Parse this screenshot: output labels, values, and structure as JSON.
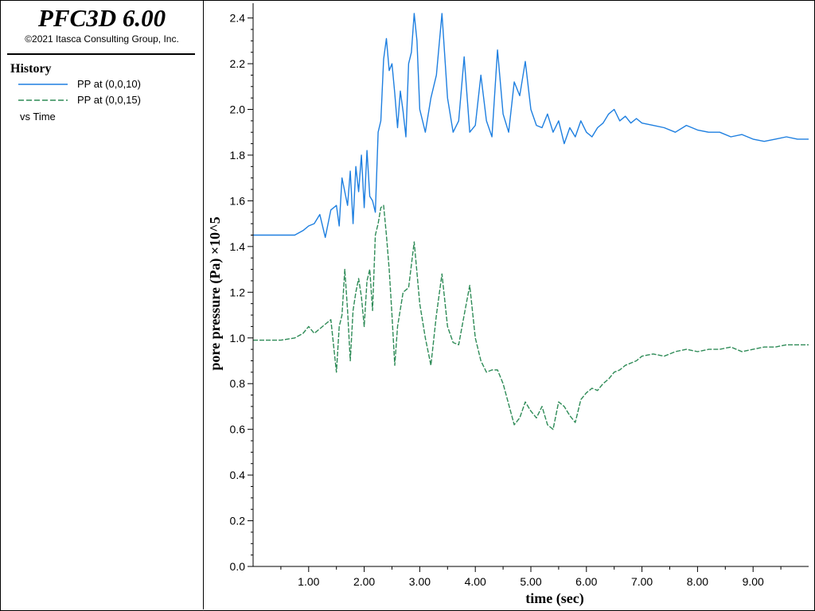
{
  "app": {
    "title": "PFC3D 6.00",
    "copyright": "©2021 Itasca Consulting Group, Inc."
  },
  "legend": {
    "heading": "History",
    "items": [
      {
        "label": "PP at (0,0,10)",
        "color": "#1e7fe0",
        "style": "solid"
      },
      {
        "label": "PP at (0,0,15)",
        "color": "#2e8b57",
        "style": "dashed"
      }
    ],
    "vs_label": "vs Time"
  },
  "chart_data": {
    "type": "line",
    "xlabel": "time (sec)",
    "ylabel": "pore pressure (Pa) ×10^5",
    "xlim": [
      0.0,
      10.0
    ],
    "ylim": [
      0.0,
      2.43
    ],
    "x_ticks": [
      "1.00",
      "2.00",
      "3.00",
      "4.00",
      "5.00",
      "6.00",
      "7.00",
      "8.00",
      "9.00"
    ],
    "y_ticks": [
      "0.0",
      "0.2",
      "0.4",
      "0.6",
      "0.8",
      "1.0",
      "1.2",
      "1.4",
      "1.6",
      "1.8",
      "2.0",
      "2.2",
      "2.4"
    ],
    "grid": false,
    "legend_position": "left-panel",
    "series": [
      {
        "name": "PP at (0,0,10)",
        "color": "#1e7fe0",
        "style": "solid",
        "x": [
          0.0,
          0.5,
          0.75,
          0.9,
          1.0,
          1.1,
          1.2,
          1.3,
          1.4,
          1.5,
          1.55,
          1.6,
          1.7,
          1.75,
          1.8,
          1.85,
          1.9,
          1.95,
          2.0,
          2.05,
          2.1,
          2.15,
          2.2,
          2.25,
          2.3,
          2.35,
          2.4,
          2.45,
          2.5,
          2.55,
          2.6,
          2.65,
          2.7,
          2.75,
          2.8,
          2.85,
          2.9,
          2.95,
          3.0,
          3.1,
          3.2,
          3.3,
          3.4,
          3.5,
          3.6,
          3.7,
          3.8,
          3.9,
          4.0,
          4.1,
          4.2,
          4.3,
          4.4,
          4.5,
          4.6,
          4.7,
          4.8,
          4.9,
          5.0,
          5.1,
          5.2,
          5.3,
          5.4,
          5.5,
          5.6,
          5.7,
          5.8,
          5.9,
          6.0,
          6.1,
          6.2,
          6.3,
          6.4,
          6.5,
          6.6,
          6.7,
          6.8,
          6.9,
          7.0,
          7.2,
          7.4,
          7.6,
          7.8,
          8.0,
          8.2,
          8.4,
          8.6,
          8.8,
          9.0,
          9.2,
          9.4,
          9.6,
          9.8,
          10.0
        ],
        "y": [
          1.45,
          1.45,
          1.45,
          1.47,
          1.49,
          1.5,
          1.54,
          1.44,
          1.56,
          1.58,
          1.49,
          1.7,
          1.58,
          1.73,
          1.5,
          1.75,
          1.64,
          1.8,
          1.57,
          1.82,
          1.62,
          1.6,
          1.55,
          1.9,
          1.95,
          2.22,
          2.31,
          2.17,
          2.2,
          2.07,
          1.92,
          2.08,
          1.99,
          1.88,
          2.2,
          2.25,
          2.42,
          2.3,
          2.0,
          1.9,
          2.05,
          2.15,
          2.42,
          2.05,
          1.9,
          1.95,
          2.23,
          1.9,
          1.93,
          2.15,
          1.95,
          1.88,
          2.26,
          1.98,
          1.9,
          2.12,
          2.06,
          2.21,
          2.0,
          1.93,
          1.92,
          1.98,
          1.9,
          1.95,
          1.85,
          1.92,
          1.88,
          1.95,
          1.9,
          1.88,
          1.92,
          1.94,
          1.98,
          2.0,
          1.95,
          1.97,
          1.94,
          1.96,
          1.94,
          1.93,
          1.92,
          1.9,
          1.93,
          1.91,
          1.9,
          1.9,
          1.88,
          1.89,
          1.87,
          1.86,
          1.87,
          1.88,
          1.87,
          1.87
        ]
      },
      {
        "name": "PP at (0,0,15)",
        "color": "#2e8b57",
        "style": "dashed",
        "x": [
          0.0,
          0.5,
          0.75,
          0.9,
          1.0,
          1.1,
          1.2,
          1.3,
          1.4,
          1.5,
          1.55,
          1.6,
          1.65,
          1.7,
          1.75,
          1.8,
          1.85,
          1.9,
          1.95,
          2.0,
          2.05,
          2.1,
          2.15,
          2.2,
          2.25,
          2.3,
          2.35,
          2.4,
          2.45,
          2.5,
          2.55,
          2.6,
          2.7,
          2.8,
          2.9,
          3.0,
          3.1,
          3.2,
          3.3,
          3.4,
          3.5,
          3.6,
          3.7,
          3.8,
          3.9,
          4.0,
          4.1,
          4.2,
          4.3,
          4.4,
          4.5,
          4.6,
          4.7,
          4.8,
          4.9,
          5.0,
          5.1,
          5.2,
          5.3,
          5.4,
          5.5,
          5.6,
          5.7,
          5.8,
          5.9,
          6.0,
          6.1,
          6.2,
          6.3,
          6.4,
          6.5,
          6.6,
          6.7,
          6.8,
          6.9,
          7.0,
          7.2,
          7.4,
          7.6,
          7.8,
          8.0,
          8.2,
          8.4,
          8.6,
          8.8,
          9.0,
          9.2,
          9.4,
          9.6,
          9.8,
          10.0
        ],
        "y": [
          0.99,
          0.99,
          1.0,
          1.02,
          1.05,
          1.02,
          1.04,
          1.06,
          1.08,
          0.85,
          1.05,
          1.1,
          1.3,
          1.12,
          0.9,
          1.12,
          1.2,
          1.26,
          1.18,
          1.05,
          1.25,
          1.3,
          1.12,
          1.45,
          1.5,
          1.57,
          1.58,
          1.45,
          1.3,
          1.1,
          0.88,
          1.05,
          1.2,
          1.22,
          1.42,
          1.15,
          1.0,
          0.88,
          1.1,
          1.28,
          1.05,
          0.98,
          0.97,
          1.1,
          1.23,
          1.0,
          0.9,
          0.85,
          0.86,
          0.86,
          0.8,
          0.71,
          0.62,
          0.65,
          0.72,
          0.68,
          0.65,
          0.7,
          0.62,
          0.6,
          0.72,
          0.7,
          0.66,
          0.63,
          0.73,
          0.76,
          0.78,
          0.77,
          0.8,
          0.82,
          0.85,
          0.86,
          0.88,
          0.89,
          0.9,
          0.92,
          0.93,
          0.92,
          0.94,
          0.95,
          0.94,
          0.95,
          0.95,
          0.96,
          0.94,
          0.95,
          0.96,
          0.96,
          0.97,
          0.97,
          0.97
        ]
      }
    ]
  }
}
